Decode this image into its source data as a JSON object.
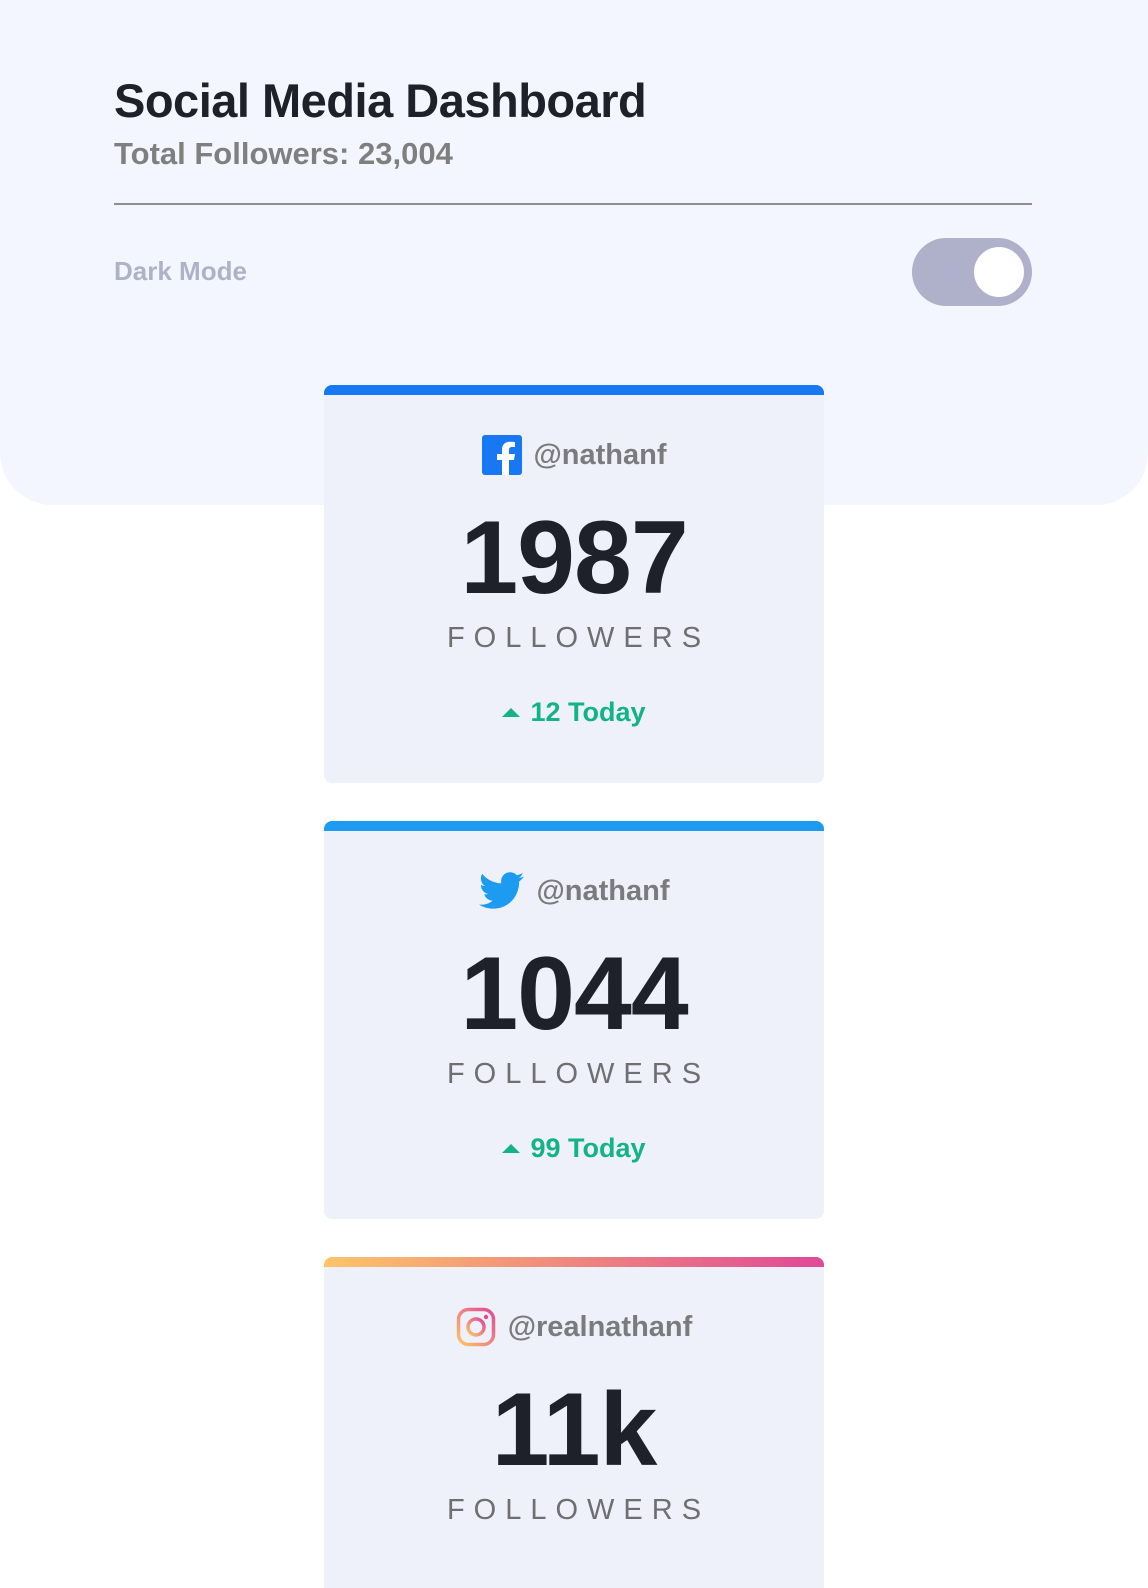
{
  "header": {
    "title": "Social Media Dashboard",
    "total_followers": "Total Followers: 23,004"
  },
  "toggle": {
    "label": "Dark Mode",
    "state": "on"
  },
  "colors": {
    "facebook": "#1877f2",
    "twitter": "#1d9bf0",
    "instagram_start": "#fdc468",
    "instagram_end": "#df4996",
    "positive": "#13b386"
  },
  "cards": [
    {
      "platform": "facebook",
      "icon": "facebook-icon",
      "handle": "@nathanf",
      "count": "1987",
      "label": "FOLLOWERS",
      "today": "12 Today"
    },
    {
      "platform": "twitter",
      "icon": "twitter-icon",
      "handle": "@nathanf",
      "count": "1044",
      "label": "FOLLOWERS",
      "today": "99 Today"
    },
    {
      "platform": "instagram",
      "icon": "instagram-icon",
      "handle": "@realnathanf",
      "count": "11k",
      "label": "FOLLOWERS"
    }
  ]
}
